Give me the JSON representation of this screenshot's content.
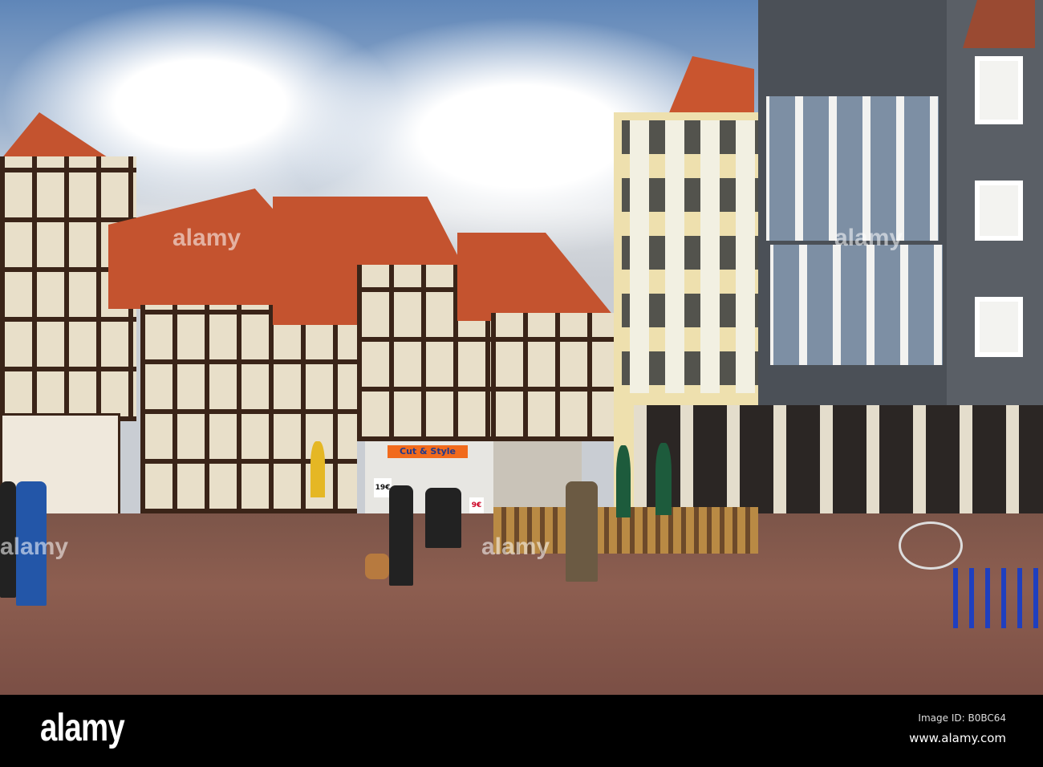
{
  "photo": {
    "shop_sign": "Cut & Style",
    "price_sign_left": "19€",
    "price_sign_right": "9€",
    "watermark": "alamy"
  },
  "footer": {
    "logo": "alamy",
    "image_id": "Image ID: B0BC64",
    "url": "www.alamy.com"
  }
}
